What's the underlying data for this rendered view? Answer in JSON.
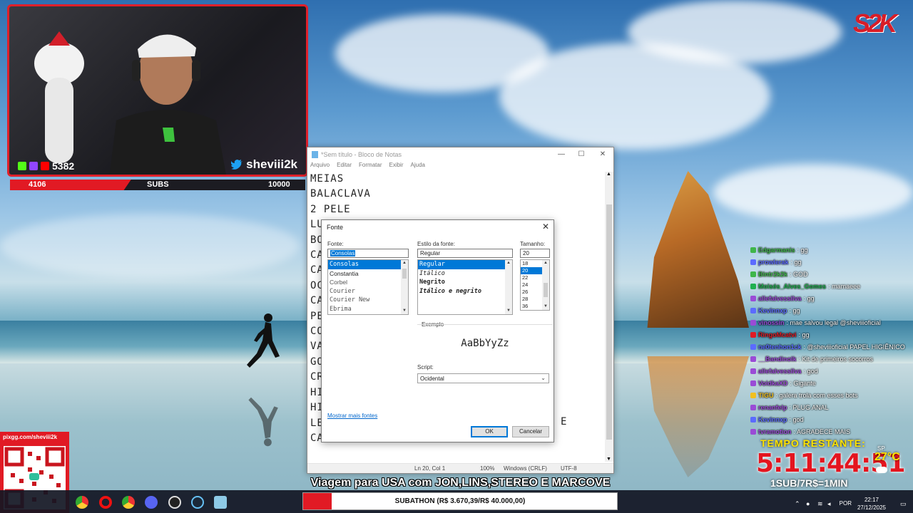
{
  "stream": {
    "viewer_count": "5382",
    "handle": "sheviii2k",
    "sub_goal": {
      "current": "4106",
      "label": "SUBS",
      "target": "10000",
      "progress_fraction": 0.41
    },
    "logo_text": "S2K",
    "qr_title": "pixgg.com/sheviii2k",
    "banner_text": "Viagem para USA com JON,LINS,STEREO E MARCOVE",
    "subathon_text": "SUBATHON (R$ 3.670,39/R$ 40.000,00)",
    "timer_label": "TEMPO RESTANTE:",
    "timer_value": "5:11:44:51",
    "timer_rate": "1SUB/7R$=1MIN",
    "weather": {
      "location": "SP",
      "temp": "27°C"
    }
  },
  "notepad": {
    "title": "*Sem título - Bloco de Notas",
    "menu": [
      "Arquivo",
      "Editar",
      "Formatar",
      "Exibir",
      "Ajuda"
    ],
    "lines": [
      "MEIAS",
      "BALACLAVA",
      "2 PELE",
      "LU",
      "BO",
      "CA",
      "CA",
      "OC",
      "CA",
      "PE",
      "CO",
      "VA",
      "GO",
      "CR",
      "HI",
      "HI",
      "LE",
      "CA"
    ],
    "line_tail": "E",
    "status": {
      "position": "Ln 20, Col 1",
      "zoom": "100%",
      "eol": "Windows (CRLF)",
      "encoding": "UTF-8"
    }
  },
  "font_dialog": {
    "title": "Fonte",
    "font_label": "Fonte:",
    "font_value": "Consolas",
    "fonts": [
      "Consolas",
      "Constantia",
      "Corbel",
      "Courier",
      "Courier New",
      "Ebrima"
    ],
    "style_label": "Estilo da fonte:",
    "style_value": "Regular",
    "styles": [
      "Regular",
      "Itálico",
      "Negrito",
      "Itálico e negrito"
    ],
    "size_label": "Tamanho:",
    "size_value": "20",
    "sizes": [
      "18",
      "20",
      "22",
      "24",
      "26",
      "28",
      "36"
    ],
    "sample_label": "Exemplo",
    "sample_text": "AaBbYyZz",
    "script_label": "Script:",
    "script_value": "Ocidental",
    "more_fonts": "Mostrar mais fontes",
    "ok": "OK",
    "cancel": "Cancelar"
  },
  "chat": [
    {
      "user": "Edgarmanis",
      "msg": ": gg",
      "color": "#3fb64a"
    },
    {
      "user": "prowlerak",
      "msg": ": gg",
      "color": "#5b6bff"
    },
    {
      "user": "Bintr2k2k",
      "msg": ": GOD",
      "color": "#3fb64a"
    },
    {
      "user": "Moisés_Alves_Gomes",
      "msg": ": mamaeee",
      "color": "#20b050"
    },
    {
      "user": "allefalvessilva",
      "msg": ": gg",
      "color": "#9a4bd6"
    },
    {
      "user": "Kevinnxp",
      "msg": ": gg",
      "color": "#5b6bff"
    },
    {
      "user": "vinossin",
      "msg": ": mae salvou legal @sheviiioficial",
      "color": "#9a4bd6"
    },
    {
      "user": "RingoMcatvi",
      "msg": ": gg",
      "color": "#e11a24"
    },
    {
      "user": "ne0tenhon1ck",
      "msg": ": @sheviiioficial PAPEL HIGIÊNICO",
      "color": "#5b6bff"
    },
    {
      "user": "__Bandinolk",
      "msg": ": Kit de primeiros socorros",
      "color": "#9a4bd6"
    },
    {
      "user": "allefalvessilva",
      "msg": ": god",
      "color": "#9a4bd6"
    },
    {
      "user": "VoidkaXD",
      "msg": ": Gigante",
      "color": "#9a4bd6"
    },
    {
      "user": "TIGU",
      "msg": ": galera trola com esses bots",
      "color": "#f0c020"
    },
    {
      "user": "renanfelp",
      "msg": ": PLUG ANAL",
      "color": "#9a4bd6"
    },
    {
      "user": "Kevinnxp",
      "msg": ": god",
      "color": "#5b6bff"
    },
    {
      "user": "tvramotion",
      "msg": ": AGRADECE MAIS",
      "color": "#9a4bd6"
    }
  ],
  "taskbar": {
    "time": "22:17",
    "date": "27/12/2025",
    "language": "POR",
    "icons": [
      "chrome-icon",
      "opera-icon",
      "chrome-alt-icon",
      "discord-icon",
      "obs-icon",
      "steam-icon",
      "notepad-icon"
    ]
  }
}
